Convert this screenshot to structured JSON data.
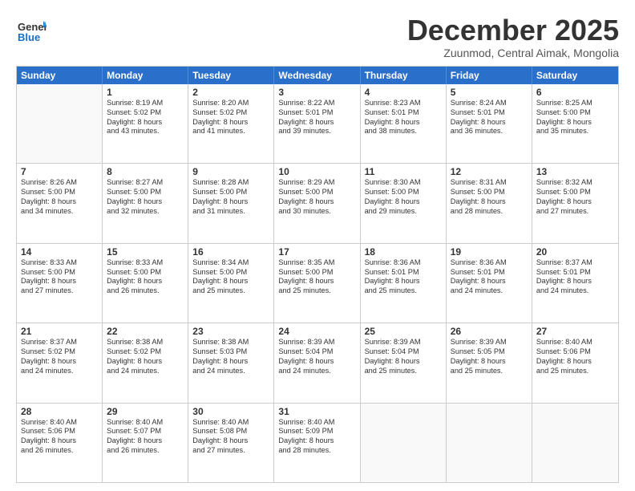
{
  "header": {
    "logo_general": "General",
    "logo_blue": "Blue",
    "title": "December 2025",
    "location": "Zuunmod, Central Aimak, Mongolia"
  },
  "weekdays": [
    "Sunday",
    "Monday",
    "Tuesday",
    "Wednesday",
    "Thursday",
    "Friday",
    "Saturday"
  ],
  "weeks": [
    [
      {
        "day": "",
        "lines": []
      },
      {
        "day": "1",
        "lines": [
          "Sunrise: 8:19 AM",
          "Sunset: 5:02 PM",
          "Daylight: 8 hours",
          "and 43 minutes."
        ]
      },
      {
        "day": "2",
        "lines": [
          "Sunrise: 8:20 AM",
          "Sunset: 5:02 PM",
          "Daylight: 8 hours",
          "and 41 minutes."
        ]
      },
      {
        "day": "3",
        "lines": [
          "Sunrise: 8:22 AM",
          "Sunset: 5:01 PM",
          "Daylight: 8 hours",
          "and 39 minutes."
        ]
      },
      {
        "day": "4",
        "lines": [
          "Sunrise: 8:23 AM",
          "Sunset: 5:01 PM",
          "Daylight: 8 hours",
          "and 38 minutes."
        ]
      },
      {
        "day": "5",
        "lines": [
          "Sunrise: 8:24 AM",
          "Sunset: 5:01 PM",
          "Daylight: 8 hours",
          "and 36 minutes."
        ]
      },
      {
        "day": "6",
        "lines": [
          "Sunrise: 8:25 AM",
          "Sunset: 5:00 PM",
          "Daylight: 8 hours",
          "and 35 minutes."
        ]
      }
    ],
    [
      {
        "day": "7",
        "lines": [
          "Sunrise: 8:26 AM",
          "Sunset: 5:00 PM",
          "Daylight: 8 hours",
          "and 34 minutes."
        ]
      },
      {
        "day": "8",
        "lines": [
          "Sunrise: 8:27 AM",
          "Sunset: 5:00 PM",
          "Daylight: 8 hours",
          "and 32 minutes."
        ]
      },
      {
        "day": "9",
        "lines": [
          "Sunrise: 8:28 AM",
          "Sunset: 5:00 PM",
          "Daylight: 8 hours",
          "and 31 minutes."
        ]
      },
      {
        "day": "10",
        "lines": [
          "Sunrise: 8:29 AM",
          "Sunset: 5:00 PM",
          "Daylight: 8 hours",
          "and 30 minutes."
        ]
      },
      {
        "day": "11",
        "lines": [
          "Sunrise: 8:30 AM",
          "Sunset: 5:00 PM",
          "Daylight: 8 hours",
          "and 29 minutes."
        ]
      },
      {
        "day": "12",
        "lines": [
          "Sunrise: 8:31 AM",
          "Sunset: 5:00 PM",
          "Daylight: 8 hours",
          "and 28 minutes."
        ]
      },
      {
        "day": "13",
        "lines": [
          "Sunrise: 8:32 AM",
          "Sunset: 5:00 PM",
          "Daylight: 8 hours",
          "and 27 minutes."
        ]
      }
    ],
    [
      {
        "day": "14",
        "lines": [
          "Sunrise: 8:33 AM",
          "Sunset: 5:00 PM",
          "Daylight: 8 hours",
          "and 27 minutes."
        ]
      },
      {
        "day": "15",
        "lines": [
          "Sunrise: 8:33 AM",
          "Sunset: 5:00 PM",
          "Daylight: 8 hours",
          "and 26 minutes."
        ]
      },
      {
        "day": "16",
        "lines": [
          "Sunrise: 8:34 AM",
          "Sunset: 5:00 PM",
          "Daylight: 8 hours",
          "and 25 minutes."
        ]
      },
      {
        "day": "17",
        "lines": [
          "Sunrise: 8:35 AM",
          "Sunset: 5:00 PM",
          "Daylight: 8 hours",
          "and 25 minutes."
        ]
      },
      {
        "day": "18",
        "lines": [
          "Sunrise: 8:36 AM",
          "Sunset: 5:01 PM",
          "Daylight: 8 hours",
          "and 25 minutes."
        ]
      },
      {
        "day": "19",
        "lines": [
          "Sunrise: 8:36 AM",
          "Sunset: 5:01 PM",
          "Daylight: 8 hours",
          "and 24 minutes."
        ]
      },
      {
        "day": "20",
        "lines": [
          "Sunrise: 8:37 AM",
          "Sunset: 5:01 PM",
          "Daylight: 8 hours",
          "and 24 minutes."
        ]
      }
    ],
    [
      {
        "day": "21",
        "lines": [
          "Sunrise: 8:37 AM",
          "Sunset: 5:02 PM",
          "Daylight: 8 hours",
          "and 24 minutes."
        ]
      },
      {
        "day": "22",
        "lines": [
          "Sunrise: 8:38 AM",
          "Sunset: 5:02 PM",
          "Daylight: 8 hours",
          "and 24 minutes."
        ]
      },
      {
        "day": "23",
        "lines": [
          "Sunrise: 8:38 AM",
          "Sunset: 5:03 PM",
          "Daylight: 8 hours",
          "and 24 minutes."
        ]
      },
      {
        "day": "24",
        "lines": [
          "Sunrise: 8:39 AM",
          "Sunset: 5:04 PM",
          "Daylight: 8 hours",
          "and 24 minutes."
        ]
      },
      {
        "day": "25",
        "lines": [
          "Sunrise: 8:39 AM",
          "Sunset: 5:04 PM",
          "Daylight: 8 hours",
          "and 25 minutes."
        ]
      },
      {
        "day": "26",
        "lines": [
          "Sunrise: 8:39 AM",
          "Sunset: 5:05 PM",
          "Daylight: 8 hours",
          "and 25 minutes."
        ]
      },
      {
        "day": "27",
        "lines": [
          "Sunrise: 8:40 AM",
          "Sunset: 5:06 PM",
          "Daylight: 8 hours",
          "and 25 minutes."
        ]
      }
    ],
    [
      {
        "day": "28",
        "lines": [
          "Sunrise: 8:40 AM",
          "Sunset: 5:06 PM",
          "Daylight: 8 hours",
          "and 26 minutes."
        ]
      },
      {
        "day": "29",
        "lines": [
          "Sunrise: 8:40 AM",
          "Sunset: 5:07 PM",
          "Daylight: 8 hours",
          "and 26 minutes."
        ]
      },
      {
        "day": "30",
        "lines": [
          "Sunrise: 8:40 AM",
          "Sunset: 5:08 PM",
          "Daylight: 8 hours",
          "and 27 minutes."
        ]
      },
      {
        "day": "31",
        "lines": [
          "Sunrise: 8:40 AM",
          "Sunset: 5:09 PM",
          "Daylight: 8 hours",
          "and 28 minutes."
        ]
      },
      {
        "day": "",
        "lines": []
      },
      {
        "day": "",
        "lines": []
      },
      {
        "day": "",
        "lines": []
      }
    ]
  ]
}
